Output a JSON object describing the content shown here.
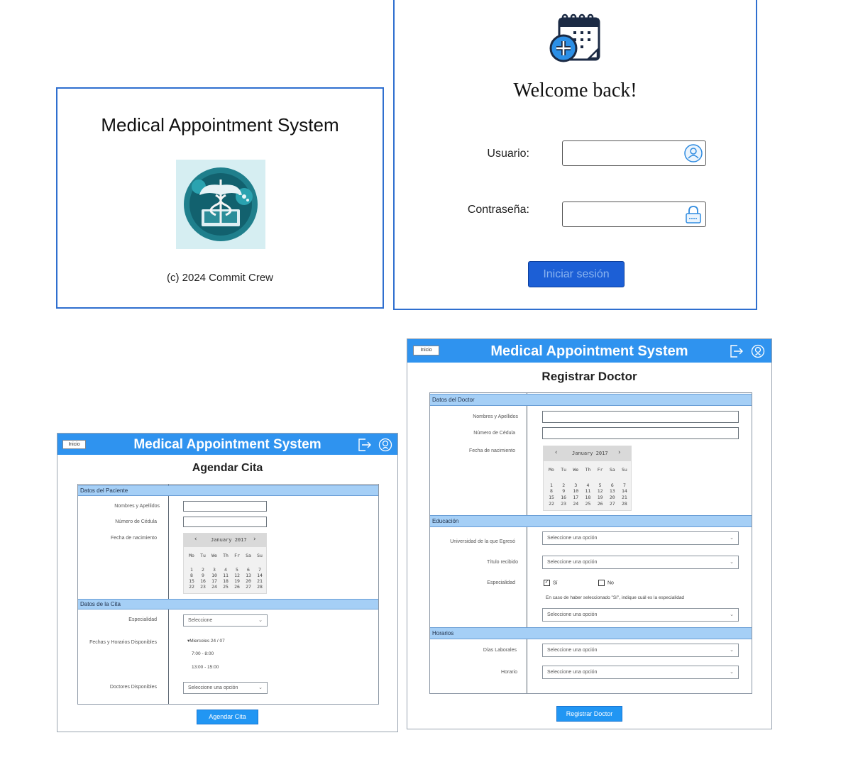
{
  "splash": {
    "title": "Medical Appointment System",
    "copyright": "(c) 2024 Commit Crew"
  },
  "login": {
    "welcome": "Welcome back!",
    "user_label": "Usuario:",
    "password_label": "Contraseña:",
    "submit_label": "Iniciar sesión"
  },
  "header": {
    "title": "Medical Appointment System",
    "home_label": "Inicio"
  },
  "calendar": {
    "month_label": "January 2017",
    "weekdays": [
      "Mo",
      "Tu",
      "We",
      "Th",
      "Fr",
      "Sa",
      "Su"
    ],
    "weeks": [
      [
        "1",
        "2",
        "3",
        "4",
        "5",
        "6",
        "7"
      ],
      [
        "8",
        "9",
        "10",
        "11",
        "12",
        "13",
        "14"
      ],
      [
        "15",
        "16",
        "17",
        "18",
        "19",
        "20",
        "21"
      ],
      [
        "22",
        "23",
        "24",
        "25",
        "26",
        "27",
        "28"
      ]
    ]
  },
  "agendar": {
    "page_title": "Agendar Cita",
    "section_patient": "Datos del Paciente",
    "name_label": "Nombres y Apellidos",
    "id_label": "Número de Cédula",
    "birth_label": "Fecha de nacimiento",
    "section_appointment": "Datos de la Cita",
    "specialty_label": "Especialidad",
    "specialty_value": "Seleccione",
    "dates_label": "Fechas y Horarios Disponibles",
    "date_group": "Miercoles 24 / 07",
    "slot_1": "7:00 - 8:00",
    "slot_2": "13:00 - 15:00",
    "doctors_label": "Doctores Disponibles",
    "doctors_value": "Seleccione una opción",
    "submit_label": "Agendar Cita"
  },
  "registrar": {
    "page_title": "Registrar Doctor",
    "section_doctor": "Datos del Doctor",
    "name_label": "Nombres y Apellidos",
    "id_label": "Número de Cédula",
    "birth_label": "Fecha de nacimiento",
    "section_education": "Educación",
    "university_label": "Universidad de la que Egresó",
    "university_value": "Seleccione una opción",
    "degree_label": "Título recibido",
    "degree_value": "Seleccione una opción",
    "specialty_label": "Especialidad",
    "yes_label": "Sí",
    "no_label": "No",
    "specialty_note": "En caso de haber seleccionado \"Sí\", indique cuál es la especialidad",
    "specialty_value": "Seleccione una opción",
    "section_schedule": "Horarios",
    "days_label": "Días Laborales",
    "days_value": "Seleccione una opción",
    "hours_label": "Horario",
    "hours_value": "Seleccione una opción",
    "submit_label": "Registrar Doctor"
  }
}
